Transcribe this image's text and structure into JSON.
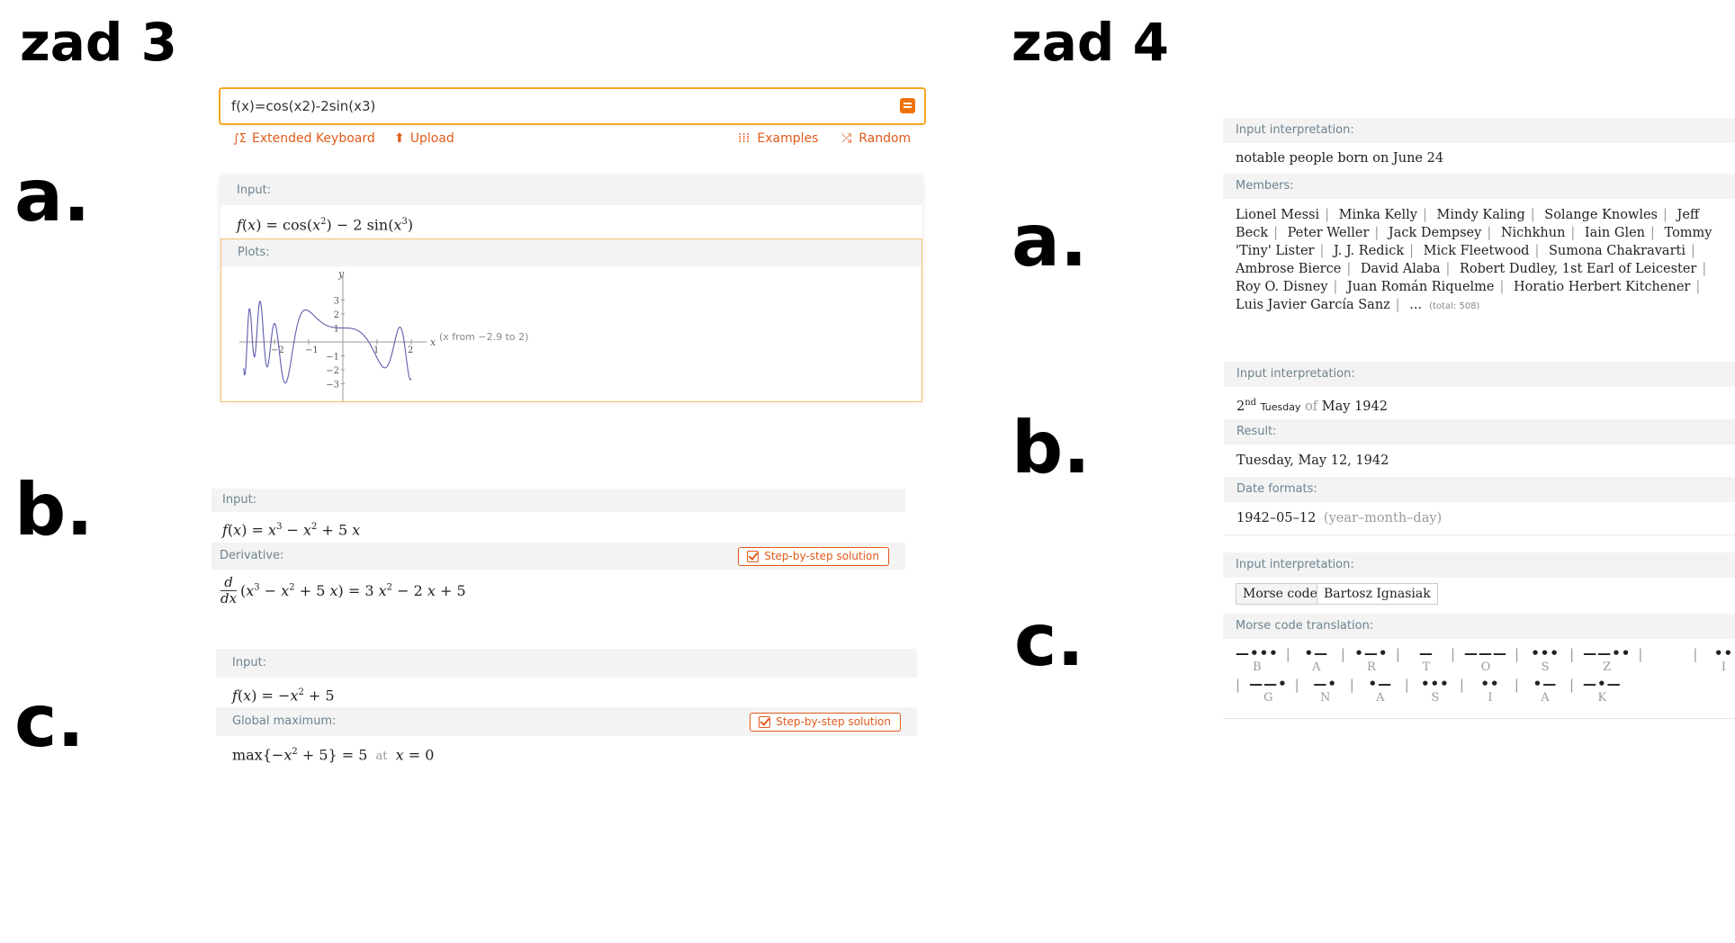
{
  "headers": {
    "left": "zad 3",
    "right": "zad 4"
  },
  "letters": {
    "a": "a.",
    "b": "b.",
    "c": "c."
  },
  "zad3": {
    "search": {
      "value": "f(x)=cos(x2)-2sin(x3)"
    },
    "toolbar": {
      "extended_keyboard": "Extended Keyboard",
      "upload": "Upload",
      "examples": "Examples",
      "random": "Random"
    },
    "a": {
      "input_label": "Input:",
      "plots_label": "Plots:",
      "plot_range": "(x from −2.9 to 2)",
      "chart_data": {
        "type": "line",
        "title": "",
        "xlabel": "x",
        "ylabel": "y",
        "xlim": [
          -2.9,
          2
        ],
        "ylim": [
          -3,
          3
        ],
        "x_ticks": [
          "−2",
          "−1",
          "1",
          "2"
        ],
        "y_ticks": [
          "3",
          "2",
          "1",
          "−1",
          "−2",
          "−3"
        ],
        "function": "cos(x^2) - 2 sin(x^3)",
        "series": [
          {
            "color": "#5e5cad"
          }
        ]
      }
    },
    "b": {
      "input_label": "Input:",
      "derivative_label": "Derivative:",
      "step_label": "Step-by-step solution"
    },
    "c": {
      "input_label": "Input:",
      "max_label": "Global maximum:",
      "step_label": "Step-by-step solution",
      "at": "at"
    }
  },
  "zad4": {
    "a": {
      "interp_label": "Input interpretation:",
      "interp_value": "notable people born on June 24",
      "members_label": "Members:",
      "members": [
        "Lionel Messi",
        "Minka Kelly",
        "Mindy Kaling",
        "Solange Knowles",
        "Jeff Beck",
        "Peter Weller",
        "Jack Dempsey",
        "Nichkhun",
        "Iain Glen",
        "Tommy 'Tiny' Lister",
        "J. J. Redick",
        "Mick Fleetwood",
        "Sumona Chakravarti",
        "Ambrose Bierce",
        "David Alaba",
        "Robert Dudley, 1st Earl of Leicester",
        "Roy O. Disney",
        "Juan Román Riquelme",
        "Horatio Herbert Kitchener",
        "Luis Javier García Sanz"
      ],
      "ellipsis": "...",
      "total": "(total: 508)"
    },
    "b": {
      "interp_label": "Input interpretation:",
      "ordinal": "2",
      "ordinal_sup": "nd",
      "weekday": "Tuesday",
      "of": "of",
      "month": "May 1942",
      "result_label": "Result:",
      "result_value": "Tuesday, May 12, 1942",
      "formats_label": "Date formats:",
      "format_value": "1942–05–12",
      "format_note": "(year–month–day)"
    },
    "c": {
      "interp_label": "Input interpretation:",
      "chip1": "Morse code",
      "chip2": "Bartosz Ignasiak",
      "trans_label": "Morse code translation:",
      "row1": [
        {
          "code": "—•••",
          "letter": "B"
        },
        {
          "code": "•—",
          "letter": "A"
        },
        {
          "code": "•—•",
          "letter": "R"
        },
        {
          "code": "—",
          "letter": "T"
        },
        {
          "code": "———",
          "letter": "O"
        },
        {
          "code": "•••",
          "letter": "S"
        },
        {
          "code": "——••",
          "letter": "Z"
        },
        {
          "code": "",
          "letter": ""
        },
        {
          "code": "••",
          "letter": "I"
        }
      ],
      "row2": [
        {
          "code": "——•",
          "letter": "G"
        },
        {
          "code": "—•",
          "letter": "N"
        },
        {
          "code": "•—",
          "letter": "A"
        },
        {
          "code": "•••",
          "letter": "S"
        },
        {
          "code": "••",
          "letter": "I"
        },
        {
          "code": "•—",
          "letter": "A"
        },
        {
          "code": "—•—",
          "letter": "K"
        }
      ]
    }
  }
}
